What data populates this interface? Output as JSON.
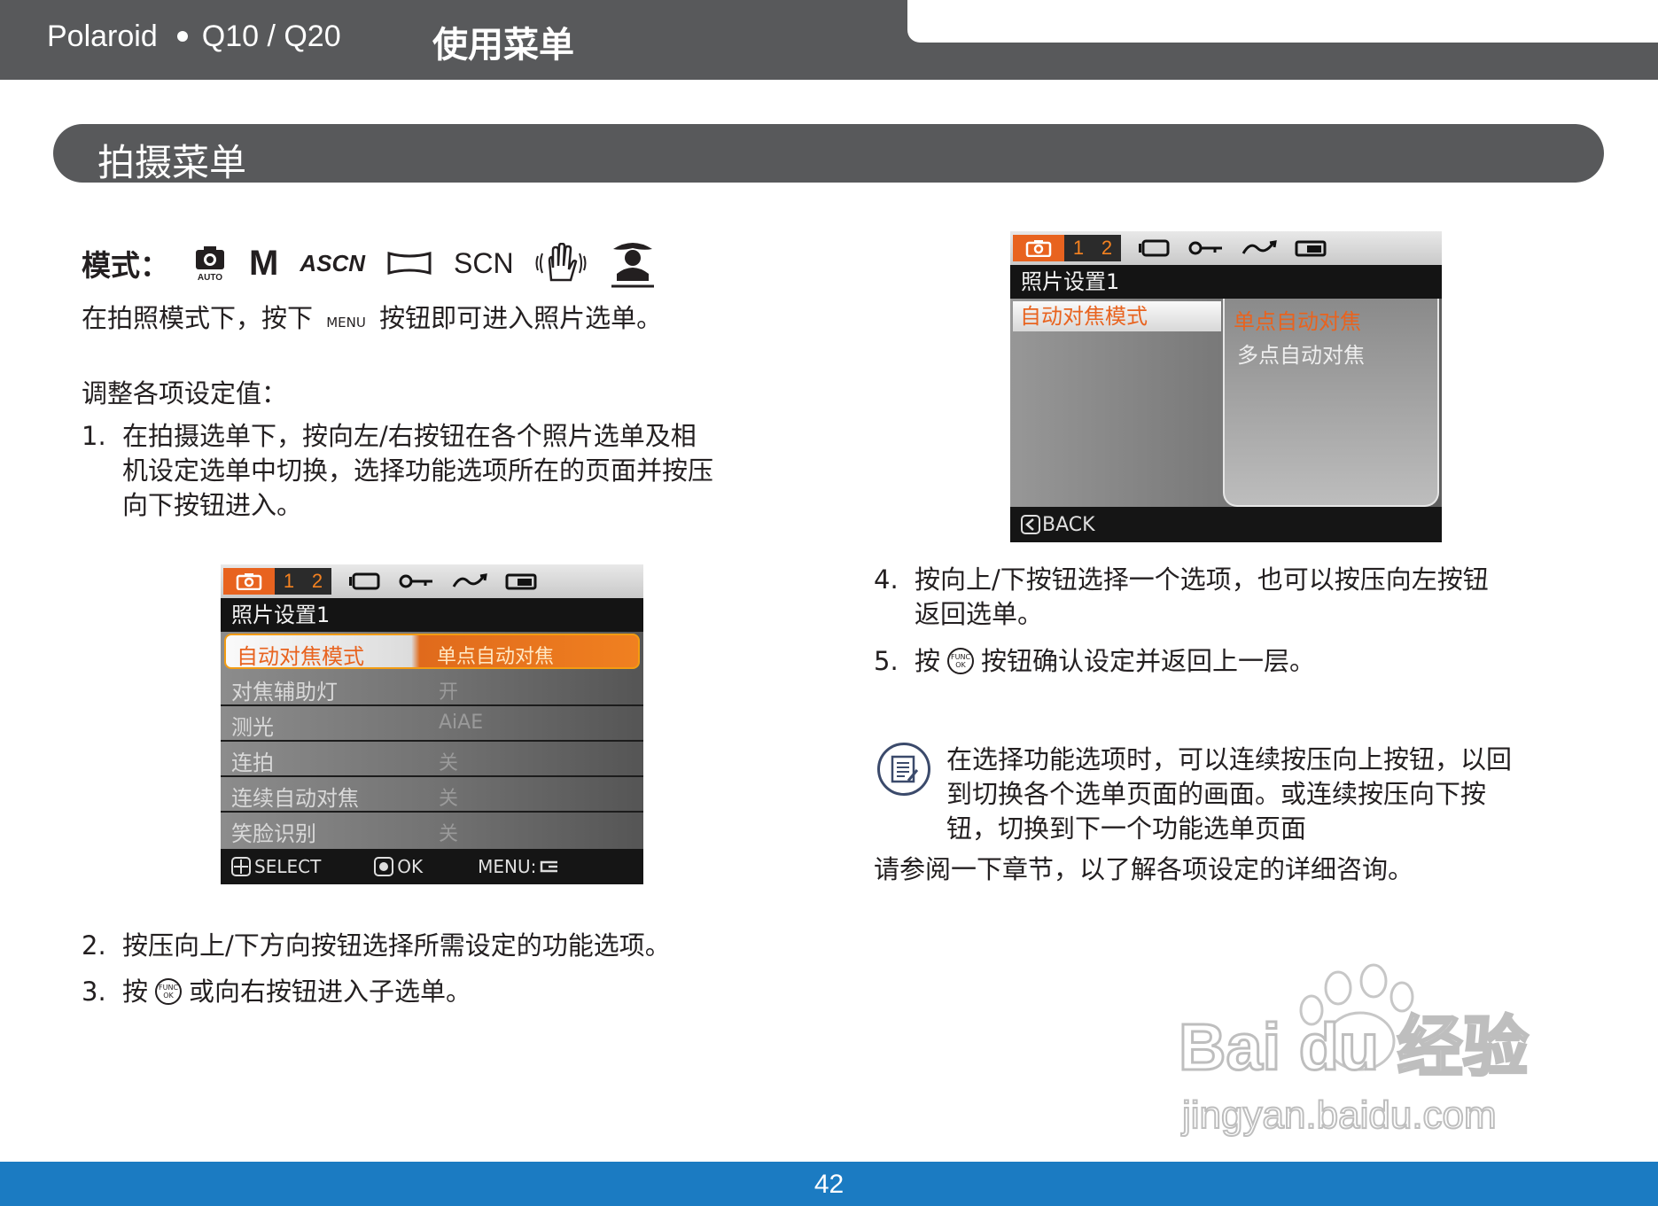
{
  "header": {
    "brand": "Polaroid",
    "model": "Q10 / Q20",
    "title": "使用菜单"
  },
  "section": {
    "title": "拍摄菜单"
  },
  "modes": {
    "label": "模式：",
    "icons": [
      "auto-camera-icon",
      "manual-m-icon",
      "asn-icon",
      "panorama-icon",
      "scn-icon",
      "anti-shake-icon",
      "portrait-icon"
    ],
    "auto_text": "AUTO",
    "m_text": "M",
    "ascn_text": "ASCN",
    "scn_text": "SCN"
  },
  "intro": {
    "before": "在拍照模式下，按下",
    "key": "MENU",
    "after": "按钮即可进入照片选单。"
  },
  "adjust_heading": "调整各项设定值：",
  "steps_left": [
    {
      "num": "1.",
      "lines": [
        "在拍摄选单下，按向左/右按钮在各个照片选单及相",
        "机设定选单中切换，选择功能选项所在的页面并按压",
        "向下按钮进入。"
      ]
    },
    {
      "num": "2.",
      "text": "按压向上/下方向按钮选择所需设定的功能选项。"
    },
    {
      "num": "3.",
      "before": "按",
      "after": "或向右按钮进入子选单。"
    }
  ],
  "steps_right": [
    {
      "num": "4.",
      "lines": [
        "按向上/下按钮选择一个选项，也可以按压向左按钮",
        "返回选单。"
      ]
    },
    {
      "num": "5.",
      "before": "按",
      "after": "按钮确认设定并返回上一层。"
    }
  ],
  "func_label": {
    "top": "FUNC",
    "bottom": "OK"
  },
  "note": {
    "lines": [
      "在选择功能选项时，可以连续按压向上按钮，以回",
      "到切换各个选单页面的画面。或连续按压向下按",
      "钮，切换到下一个功能选单页面"
    ],
    "after": "请参阅一下章节，以了解各项设定的详细咨询。"
  },
  "camera_screen_1": {
    "tab_numbers": [
      "1",
      "2"
    ],
    "header": "照片设置1",
    "rows": [
      {
        "label": "自动对焦模式",
        "value": "单点自动对焦",
        "selected": true
      },
      {
        "label": "对焦辅助灯",
        "value": "开"
      },
      {
        "label": "测光",
        "value": "AiAE"
      },
      {
        "label": "连拍",
        "value": "关"
      },
      {
        "label": "连续自动对焦",
        "value": "关"
      },
      {
        "label": "笑脸识别",
        "value": "关"
      }
    ],
    "footer": {
      "select": "SELECT",
      "ok": "OK",
      "menu": "MENU:"
    }
  },
  "camera_screen_2": {
    "tab_numbers": [
      "1",
      "2"
    ],
    "header": "照片设置1",
    "selected_item": "自动对焦模式",
    "options": [
      "单点自动对焦",
      "多点自动对焦"
    ],
    "footer_back": "BACK"
  },
  "watermark": {
    "logo": "Bai du 经验",
    "url": "jingyan.baidu.com"
  },
  "page_number": "42",
  "colors": {
    "header_gray": "#58595b",
    "footer_blue": "#1b7bc2",
    "accent_orange": "#e8631f"
  }
}
